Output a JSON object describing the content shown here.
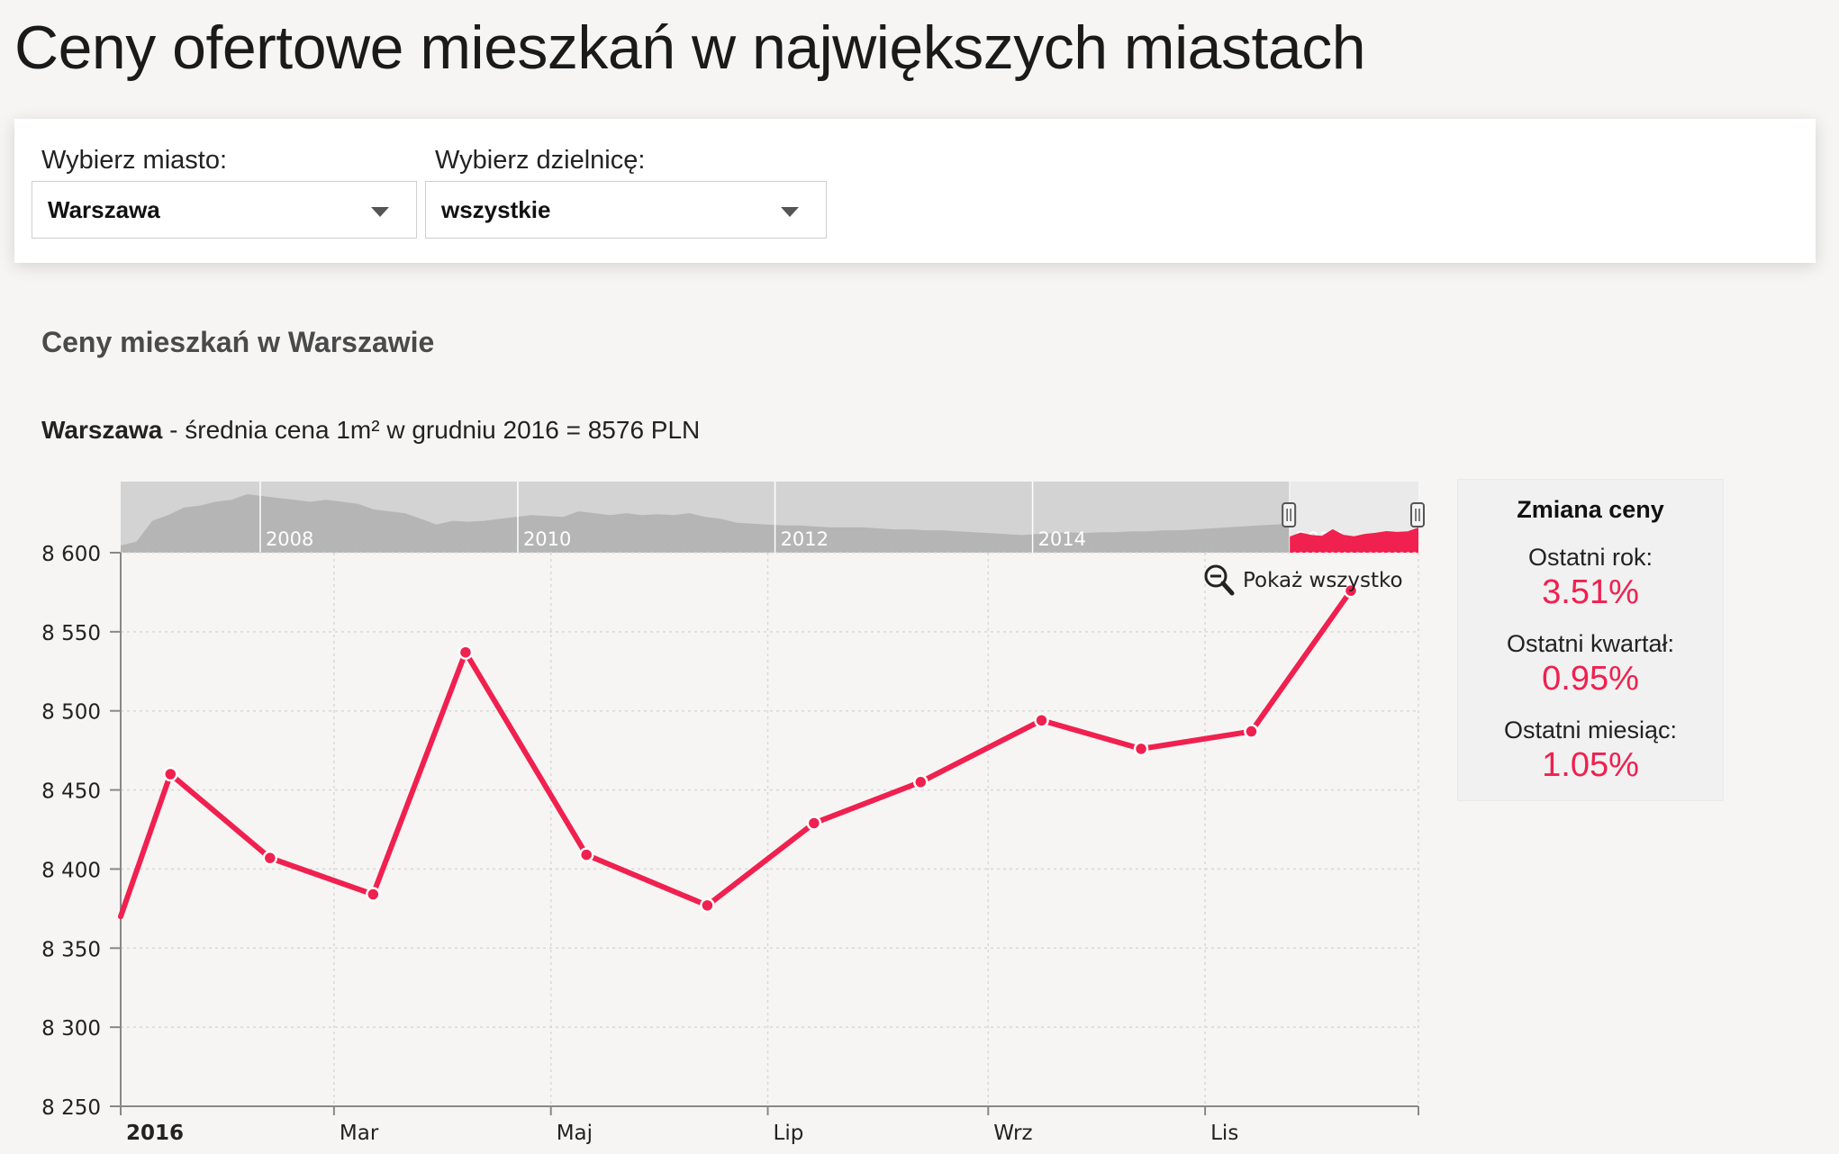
{
  "page_title": "Ceny ofertowe mieszkań w największych miastach",
  "filters": {
    "city_label": "Wybierz miasto:",
    "city_value": "Warszawa",
    "district_label": "Wybierz dzielnicę:",
    "district_value": "wszystkie"
  },
  "section_title": "Ceny mieszkań w Warszawie",
  "subtitle": {
    "city": "Warszawa",
    "text": " - średnia cena 1m² w grudniu 2016 = 8576 PLN"
  },
  "stats": {
    "title": "Zmiana ceny",
    "items": [
      {
        "label": "Ostatni rok:",
        "value": "3.51%"
      },
      {
        "label": "Ostatni kwartał:",
        "value": "0.95%"
      },
      {
        "label": "Ostatni miesiąc:",
        "value": "1.05%"
      }
    ]
  },
  "show_all_label": "Pokaż wszystko",
  "colors": {
    "accent": "#f0204f",
    "navigator_fill": "#b5b5b5",
    "navigator_bg": "#d3d3d3"
  },
  "chart_data": {
    "type": "line",
    "title": "",
    "xlabel": "",
    "ylabel": "",
    "ylim": [
      8250,
      8600
    ],
    "y_ticks": [
      8250,
      8300,
      8350,
      8400,
      8450,
      8500,
      8550,
      8600
    ],
    "y_tick_labels": [
      "8 250",
      "8 300",
      "8 350",
      "8 400",
      "8 450",
      "8 500",
      "8 550",
      "8 600"
    ],
    "xlim": [
      "2016-01-01",
      "2016-12-31"
    ],
    "x_ticks": [
      {
        "date": "2016-01-01",
        "label": "2016",
        "bold": true
      },
      {
        "date": "2016-03-01",
        "label": "Mar"
      },
      {
        "date": "2016-05-01",
        "label": "Maj"
      },
      {
        "date": "2016-07-01",
        "label": "Lip"
      },
      {
        "date": "2016-09-01",
        "label": "Wrz"
      },
      {
        "date": "2016-11-01",
        "label": "Lis"
      }
    ],
    "grid": true,
    "series": [
      {
        "name": "",
        "color": "#f0204f",
        "x": [
          "2015-12-31",
          "2016-01-15",
          "2016-02-12",
          "2016-03-12",
          "2016-04-07",
          "2016-05-11",
          "2016-06-14",
          "2016-07-14",
          "2016-08-13",
          "2016-09-16",
          "2016-10-14",
          "2016-11-14",
          "2016-12-12"
        ],
        "values": [
          8370,
          8460,
          8407,
          8384,
          8537,
          8409,
          8377,
          8429,
          8455,
          8494,
          8476,
          8487,
          8576
        ],
        "markers": [
          false,
          true,
          true,
          true,
          true,
          true,
          true,
          true,
          true,
          true,
          true,
          true,
          true
        ]
      }
    ],
    "navigator": {
      "year_labels": [
        "2008",
        "2010",
        "2012",
        "2014",
        "2016"
      ],
      "year_dates": [
        "2008-01-01",
        "2010-01-01",
        "2012-01-01",
        "2014-01-01",
        "2016-01-01"
      ],
      "xlim": [
        "2006-12-01",
        "2016-12-31"
      ],
      "selected_range": [
        "2016-01-01",
        "2016-12-31"
      ],
      "history_values": [
        7000,
        7200,
        8300,
        8600,
        9000,
        9100,
        9300,
        9400,
        9700,
        9600,
        9500,
        9400,
        9300,
        9400,
        9300,
        9200,
        8900,
        8800,
        8700,
        8400,
        8100,
        8300,
        8250,
        8300,
        8400,
        8500,
        8600,
        8550,
        8500,
        8800,
        8700,
        8600,
        8700,
        8600,
        8650,
        8600,
        8700,
        8500,
        8400,
        8200,
        8150,
        8100,
        8050,
        8050,
        8000,
        7950,
        7950,
        7950,
        7900,
        7850,
        7850,
        7800,
        7800,
        7750,
        7700,
        7650,
        7600,
        7550,
        7600,
        7650,
        7700,
        7650,
        7700,
        7700,
        7750,
        7750,
        7800,
        7800,
        7850,
        7900,
        7950,
        8000,
        8050,
        8100,
        8150
      ]
    }
  }
}
